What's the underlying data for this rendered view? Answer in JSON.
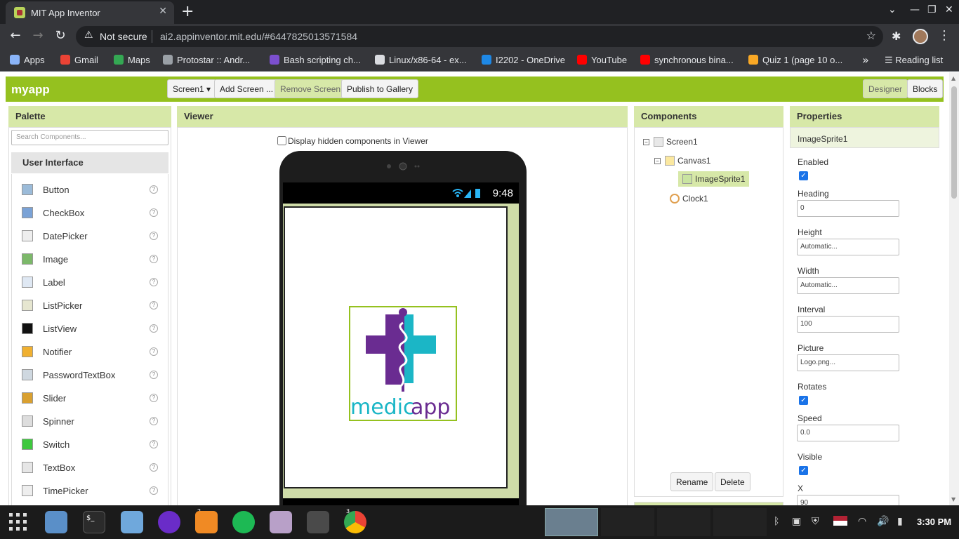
{
  "browser": {
    "tab_title": "MIT App Inventor",
    "security_label": "Not secure",
    "url": "ai2.appinventor.mit.edu/#6447825013571584",
    "bookmarks": [
      {
        "label": "Apps",
        "color": "#8ab4f8"
      },
      {
        "label": "Gmail",
        "color": "#ea4335"
      },
      {
        "label": "Maps",
        "color": "#34a853"
      },
      {
        "label": "Protostar :: Andr...",
        "color": "#9aa0a6"
      },
      {
        "label": "Bash scripting ch...",
        "color": "#7b4fcf"
      },
      {
        "label": "Linux/x86-64 - ex...",
        "color": "#dadce0"
      },
      {
        "label": "I2202 - OneDrive",
        "color": "#1e88e5"
      },
      {
        "label": "YouTube",
        "color": "#ff0000"
      },
      {
        "label": "synchronous bina...",
        "color": "#ff0000"
      },
      {
        "label": "Quiz 1 (page 10 o...",
        "color": "#f9a825"
      }
    ],
    "reading_list": "Reading list"
  },
  "app": {
    "project_name": "myapp",
    "toolbar": {
      "screen_select": "Screen1 ▾",
      "add_screen": "Add Screen ...",
      "remove_screen": "Remove Screen",
      "publish": "Publish to Gallery",
      "designer": "Designer",
      "blocks": "Blocks"
    },
    "palette": {
      "title": "Palette",
      "search_placeholder": "Search Components...",
      "category": "User Interface",
      "items": [
        {
          "label": "Button",
          "icon": "button-icon"
        },
        {
          "label": "CheckBox",
          "icon": "checkbox-icon"
        },
        {
          "label": "DatePicker",
          "icon": "datepicker-icon"
        },
        {
          "label": "Image",
          "icon": "image-icon"
        },
        {
          "label": "Label",
          "icon": "label-icon"
        },
        {
          "label": "ListPicker",
          "icon": "listpicker-icon"
        },
        {
          "label": "ListView",
          "icon": "listview-icon"
        },
        {
          "label": "Notifier",
          "icon": "notifier-icon"
        },
        {
          "label": "PasswordTextBox",
          "icon": "password-icon"
        },
        {
          "label": "Slider",
          "icon": "slider-icon"
        },
        {
          "label": "Spinner",
          "icon": "spinner-icon"
        },
        {
          "label": "Switch",
          "icon": "switch-icon"
        },
        {
          "label": "TextBox",
          "icon": "textbox-icon"
        },
        {
          "label": "TimePicker",
          "icon": "timepicker-icon"
        }
      ],
      "help_glyph": "?"
    },
    "viewer": {
      "title": "Viewer",
      "hidden_checkbox_label": "Display hidden components in Viewer",
      "phone_time": "9:48",
      "logo_text_1": "medic",
      "logo_text_2": "app"
    },
    "components": {
      "title": "Components",
      "tree": [
        "Screen1",
        "Canvas1",
        "ImageSprite1",
        "Clock1"
      ],
      "rename": "Rename",
      "delete": "Delete",
      "collapse_glyph": "−"
    },
    "properties": {
      "title": "Properties",
      "selected": "ImageSprite1",
      "enabled_label": "Enabled",
      "heading_label": "Heading",
      "heading_value": "0",
      "height_label": "Height",
      "height_value": "Automatic...",
      "width_label": "Width",
      "width_value": "Automatic...",
      "interval_label": "Interval",
      "interval_value": "100",
      "picture_label": "Picture",
      "picture_value": "Logo.png...",
      "rotates_label": "Rotates",
      "speed_label": "Speed",
      "speed_value": "0.0",
      "visible_label": "Visible",
      "x_label": "X",
      "x_value": "90",
      "check_glyph": "✓"
    }
  },
  "taskbar": {
    "clock": "3:30 PM",
    "badge_files": "2",
    "badge_chrome": "3"
  }
}
